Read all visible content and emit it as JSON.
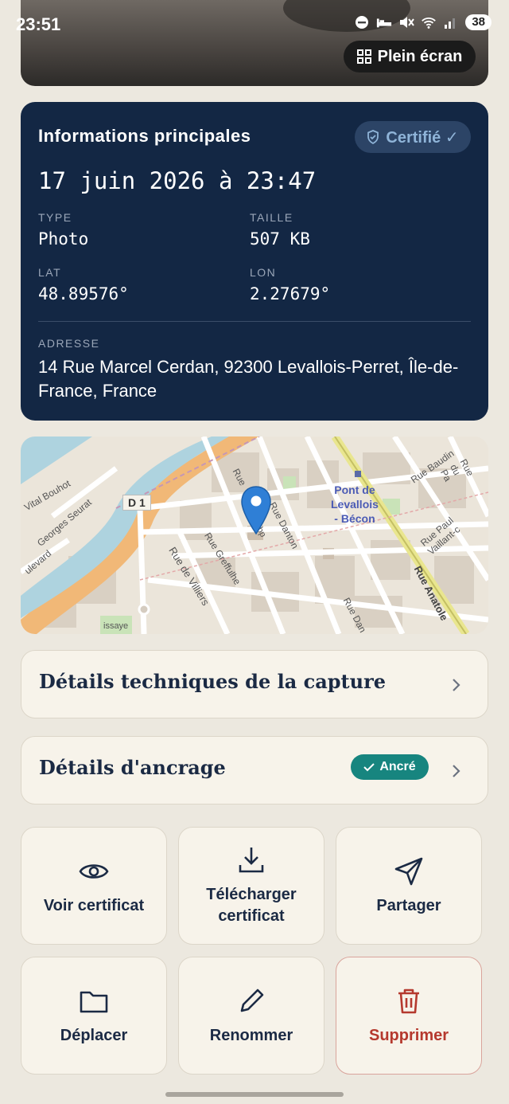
{
  "status_bar": {
    "time": "23:51",
    "battery": "38",
    "icons": [
      "dnd-icon",
      "sleep-icon",
      "mute-icon",
      "wifi-icon",
      "signal-icon"
    ]
  },
  "photo": {
    "fullscreen_label": "Plein écran"
  },
  "info": {
    "title": "Informations principales",
    "certified_label": "Certifié ✓",
    "date": "17 juin 2026 à 23:47",
    "type_label": "TYPE",
    "type_value": "Photo",
    "size_label": "TAILLE",
    "size_value": "507 KB",
    "lat_label": "LAT",
    "lat_value": "48.89576°",
    "lon_label": "LON",
    "lon_value": "2.27679°",
    "address_label": "ADRESSE",
    "address_value": "14 Rue Marcel Cerdan, 92300 Levallois-Perret, Île-de-France, France"
  },
  "map": {
    "labels": {
      "d1": "D 1",
      "station_1": "Pont de",
      "station_2": "Levallois",
      "station_3": "- Bécon",
      "rue_danton": "Rue Danton",
      "rue_villiers": "Rue de Villiers",
      "rue_greffulhe": "Rue Greffulhe",
      "rue_baudin": "Rue Baudin",
      "rue_paul_vaillant": "Rue Paul Vaillant-c",
      "rue_anatole": "Rue Anatole",
      "vital_bouhot": "Vital Bouhot",
      "georges_seurat": "Georges Seurat",
      "boulevard": "ulevard",
      "rue_du_pa": "Rue du Pa",
      "issaye": "issaye",
      "rue": "Rue",
      "rue_dan": "Rue Dan",
      "bp": "bp"
    }
  },
  "capture_details": {
    "title": "Détails techniques de la capture"
  },
  "anchor_details": {
    "title": "Détails d'ancrage",
    "badge": "Ancré"
  },
  "actions": {
    "view_certificate": "Voir certificat",
    "download_certificate_1": "Télécharger",
    "download_certificate_2": "certificat",
    "share": "Partager",
    "move": "Déplacer",
    "rename": "Renommer",
    "delete": "Supprimer"
  },
  "colors": {
    "background": "#ece8df",
    "card_dark": "#132744",
    "accent_teal": "#17857f",
    "danger": "#b5392e",
    "marker": "#2f7fd6"
  }
}
